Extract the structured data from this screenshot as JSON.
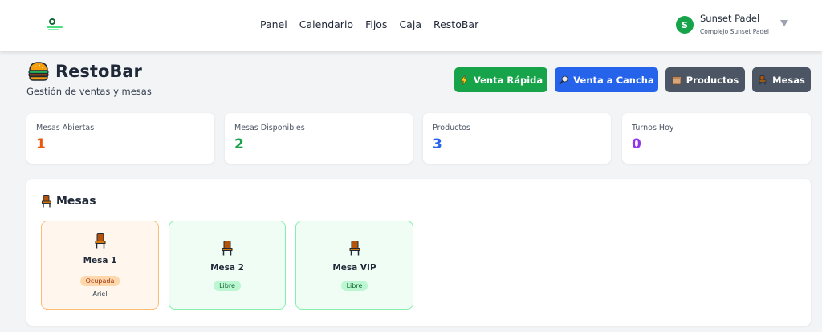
{
  "nav": {
    "links": [
      "Panel",
      "Calendario",
      "Fijos",
      "Caja",
      "RestoBar"
    ]
  },
  "user": {
    "initial": "S",
    "name": "Sunset Padel",
    "subtitle": "Complejo Sunset Padel"
  },
  "header": {
    "title": "RestoBar",
    "subtitle": "Gestión de ventas y mesas"
  },
  "actions": {
    "venta_rapida": "Venta Rápida",
    "venta_cancha": "Venta a Cancha",
    "productos": "Productos",
    "mesas": "Mesas"
  },
  "stats": [
    {
      "label": "Mesas Abiertas",
      "value": "1",
      "color": "#ea580c"
    },
    {
      "label": "Mesas Disponibles",
      "value": "2",
      "color": "#16a34a"
    },
    {
      "label": "Productos",
      "value": "3",
      "color": "#2563eb"
    },
    {
      "label": "Turnos Hoy",
      "value": "0",
      "color": "#9333ea"
    }
  ],
  "panel": {
    "title": "Mesas",
    "tables": [
      {
        "name": "Mesa 1",
        "status": "Ocupada",
        "client": "Ariel"
      },
      {
        "name": "Mesa 2",
        "status": "Libre"
      },
      {
        "name": "Mesa VIP",
        "status": "Libre"
      }
    ]
  },
  "colors": {
    "accent_green": "#16a34a",
    "accent_blue": "#2563eb",
    "neutral_button": "#4b5563"
  },
  "icons": {
    "logo": "padel-logo-icon",
    "dropdown": "chevron-down-icon",
    "header": "burger-icon",
    "venta_rapida": "lightning-icon",
    "venta_cancha": "racket-icon",
    "productos": "box-icon",
    "mesas": "chair-icon"
  }
}
